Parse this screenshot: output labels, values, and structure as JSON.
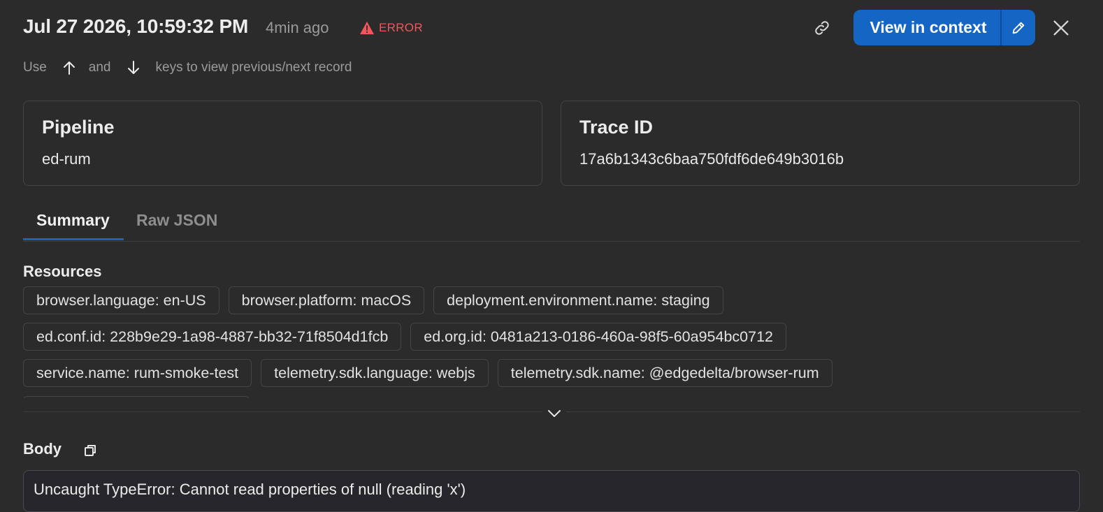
{
  "header": {
    "timestamp": "Jul 27 2026, 10:59:32 PM",
    "relative_time": "4min ago",
    "severity": "ERROR",
    "view_in_context_label": "View in context",
    "icons": {
      "link": "link-icon",
      "edit": "pencil-icon",
      "close": "close-icon",
      "warning": "warning-icon"
    }
  },
  "hint": {
    "use": "Use",
    "and": "and",
    "suffix": "keys to view previous/next record"
  },
  "cards": {
    "pipeline": {
      "label": "Pipeline",
      "value": "ed-rum"
    },
    "trace": {
      "label": "Trace ID",
      "value": "17a6b1343c6baa750fdf6de649b3016b"
    }
  },
  "tabs": [
    {
      "label": "Summary",
      "active": true
    },
    {
      "label": "Raw JSON",
      "active": false
    }
  ],
  "resources": {
    "title": "Resources",
    "rows": [
      [
        "browser.language: en-US",
        "browser.platform: macOS",
        "deployment.environment.name: staging"
      ],
      [
        "ed.conf.id: 228b9e29-1a98-4887-bb32-71f8504d1fcb",
        "ed.org.id: 0481a213-0186-460a-98f5-60a954bc0712"
      ],
      [
        "service.name: rum-smoke-test",
        "telemetry.sdk.language: webjs",
        "telemetry.sdk.name: @edgedelta/browser-rum"
      ]
    ]
  },
  "body": {
    "title": "Body",
    "text": "Uncaught TypeError: Cannot read properties of null (reading 'x')"
  },
  "colors": {
    "background": "#2b2b2b",
    "accent": "#1566c4",
    "error": "#f0565a"
  }
}
